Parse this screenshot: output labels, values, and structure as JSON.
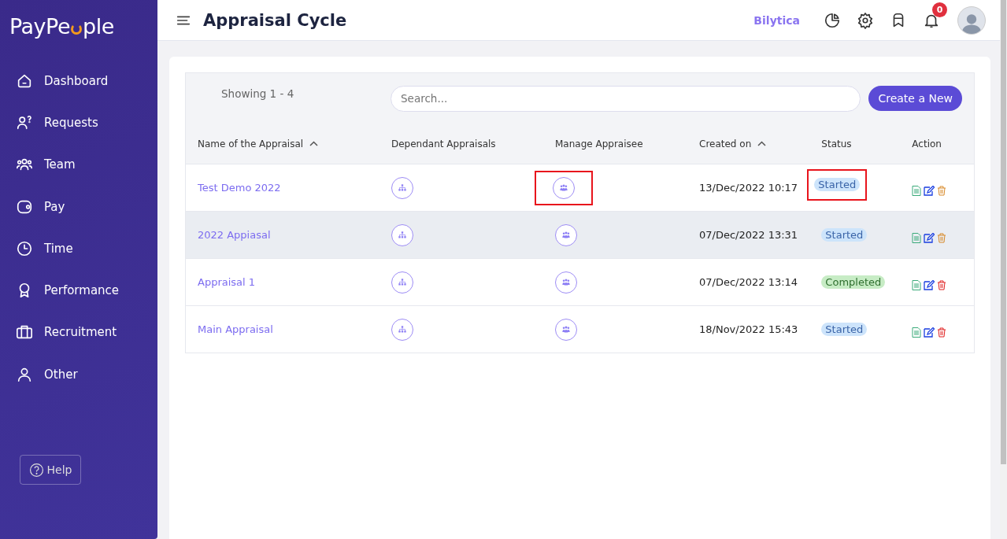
{
  "sidebar": {
    "logo": {
      "text_before": "PayPe",
      "text_after": "ple"
    },
    "items": [
      {
        "label": "Dashboard",
        "selected": false
      },
      {
        "label": "Requests",
        "selected": false
      },
      {
        "label": "Team",
        "selected": false
      },
      {
        "label": "Pay",
        "selected": false
      },
      {
        "label": "Time",
        "selected": false
      },
      {
        "label": "Performance",
        "selected": false
      },
      {
        "label": "Recruitment",
        "selected": false
      },
      {
        "label": "Other",
        "selected": false
      }
    ],
    "help": "Help"
  },
  "header": {
    "title": "Appraisal Cycle",
    "company": "Bilytica",
    "notification_count": "0"
  },
  "toolbar": {
    "showing": "Showing 1 - 4",
    "search_placeholder": "Search...",
    "create_button": "Create a New"
  },
  "table": {
    "columns": [
      {
        "label": "Name of the Appraisal",
        "sortable": true
      },
      {
        "label": "Dependant Appraisals",
        "sortable": false
      },
      {
        "label": "Manage Appraisee",
        "sortable": false
      },
      {
        "label": "Created on",
        "sortable": true
      },
      {
        "label": "Status",
        "sortable": false
      },
      {
        "label": "Action",
        "sortable": false
      }
    ],
    "rows": [
      {
        "name": "Test Demo 2022",
        "created": "13/Dec/2022 10:17",
        "status": {
          "label": "Started",
          "kind": "started"
        },
        "selected": false,
        "manage_highlighted": true,
        "status_highlighted": true
      },
      {
        "name": "2022 Appiasal",
        "created": "07/Dec/2022 13:31",
        "status": {
          "label": "Started",
          "kind": "started"
        },
        "selected": true,
        "manage_highlighted": false,
        "status_highlighted": false
      },
      {
        "name": "Appraisal 1",
        "created": "07/Dec/2022 13:14",
        "status": {
          "label": "Completed",
          "kind": "completed"
        },
        "selected": false,
        "manage_highlighted": false,
        "status_highlighted": false
      },
      {
        "name": "Main Appraisal",
        "created": "18/Nov/2022 15:43",
        "status": {
          "label": "Started",
          "kind": "started"
        },
        "selected": false,
        "manage_highlighted": false,
        "status_highlighted": false
      }
    ]
  }
}
